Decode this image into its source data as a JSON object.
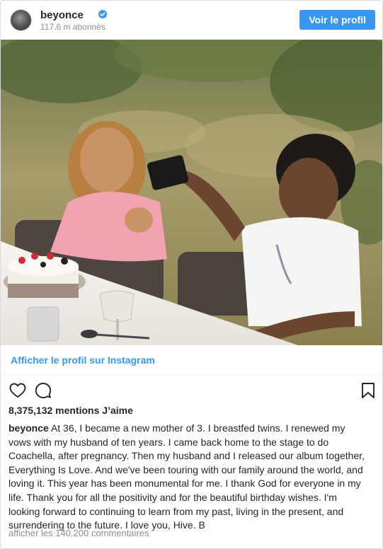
{
  "header": {
    "username": "beyonce",
    "followers": "117.6 m abonnés",
    "view_profile_label": "Voir le profil"
  },
  "post": {
    "instagram_link": "Afficher le profil sur Instagram",
    "likes": "8,375,132 mentions J’aime",
    "caption_user": "beyonce",
    "caption_text": "At 36, I became a new mother of 3. I breastfed twins. I renewed my vows with my husband of ten years. I came back home to the stage to do Coachella, after pregnancy. Then my husband and I released our album together, Everything Is Love. And we've been touring with our family around the world, and loving it. This year has been monumental for me. I thank God for everyone in my life. Thank you for all the positivity and for the beautiful birthday wishes. I'm looking forward to continuing to learn from my past, living in the present, and surrendering to the future. I love you, Hive. B",
    "comments_link": "afficher les 140,200 commentaires"
  },
  "icons": {
    "verified": "verified-badge-icon",
    "like": "heart-icon",
    "comment": "comment-bubble-icon",
    "save": "bookmark-icon"
  },
  "colors": {
    "accent": "#3897f0",
    "text": "#262626",
    "muted": "#8e8e8e",
    "border": "#dbdbdb"
  }
}
